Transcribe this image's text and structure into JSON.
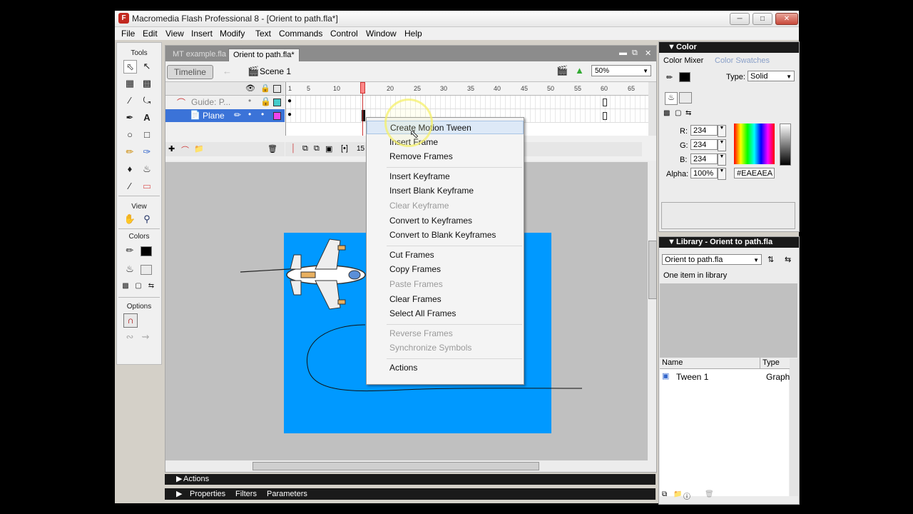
{
  "window": {
    "title": "Macromedia Flash Professional 8 - [Orient to path.fla*]",
    "app_icon": "F"
  },
  "menubar": [
    "File",
    "Edit",
    "View",
    "Insert",
    "Modify",
    "Text",
    "Commands",
    "Control",
    "Window",
    "Help"
  ],
  "tools": {
    "title": "Tools",
    "view_label": "View",
    "colors_label": "Colors",
    "options_label": "Options"
  },
  "document": {
    "tabs": [
      "MT example.fla",
      "Orient to path.fla*"
    ],
    "timeline_button": "Timeline",
    "scene": "Scene 1",
    "zoom": "50%",
    "ruler_numbers": [
      "1",
      "5",
      "10",
      "15",
      "20",
      "25",
      "30",
      "35",
      "40",
      "45",
      "50",
      "55",
      "60",
      "65"
    ],
    "layers": [
      {
        "name": "Guide: P...",
        "type": "guide"
      },
      {
        "name": "Plane",
        "type": "normal"
      }
    ],
    "current_frame": "15"
  },
  "context_menu": {
    "items": [
      {
        "label": "Create Motion Tween",
        "state": "highlighted"
      },
      {
        "label": "Insert Frame",
        "state": "enabled"
      },
      {
        "label": "Remove Frames",
        "state": "enabled"
      },
      {
        "sep": true
      },
      {
        "label": "Insert Keyframe",
        "state": "enabled"
      },
      {
        "label": "Insert Blank Keyframe",
        "state": "enabled"
      },
      {
        "label": "Clear Keyframe",
        "state": "disabled"
      },
      {
        "label": "Convert to Keyframes",
        "state": "enabled"
      },
      {
        "label": "Convert to Blank Keyframes",
        "state": "enabled"
      },
      {
        "sep": true
      },
      {
        "label": "Cut Frames",
        "state": "enabled"
      },
      {
        "label": "Copy Frames",
        "state": "enabled"
      },
      {
        "label": "Paste Frames",
        "state": "disabled"
      },
      {
        "label": "Clear Frames",
        "state": "enabled"
      },
      {
        "label": "Select All Frames",
        "state": "enabled"
      },
      {
        "sep": true
      },
      {
        "label": "Reverse Frames",
        "state": "disabled"
      },
      {
        "label": "Synchronize Symbols",
        "state": "disabled"
      },
      {
        "sep": true
      },
      {
        "label": "Actions",
        "state": "enabled"
      }
    ]
  },
  "bottom_panels": {
    "actions": "Actions",
    "tabs": [
      "Properties",
      "Filters",
      "Parameters"
    ]
  },
  "color_panel": {
    "title": "Color",
    "tabs": [
      "Color Mixer",
      "Color Swatches"
    ],
    "type_label": "Type:",
    "type_value": "Solid",
    "r_label": "R:",
    "r_value": "234",
    "g_label": "G:",
    "g_value": "234",
    "b_label": "B:",
    "b_value": "234",
    "alpha_label": "Alpha:",
    "alpha_value": "100%",
    "hex": "#EAEAEA"
  },
  "library_panel": {
    "title": "Library - Orient to path.fla",
    "doc_select": "Orient to path.fla",
    "count_text": "One item in library",
    "col_name": "Name",
    "col_type": "Type",
    "items": [
      {
        "name": "Tween 1",
        "type": "Graph"
      }
    ]
  },
  "colors": {
    "stage": "#0099ff",
    "selected_layer": "#3b73d8",
    "panel_header": "#1a1a1a",
    "menu_highlight": "#dde9f7"
  }
}
